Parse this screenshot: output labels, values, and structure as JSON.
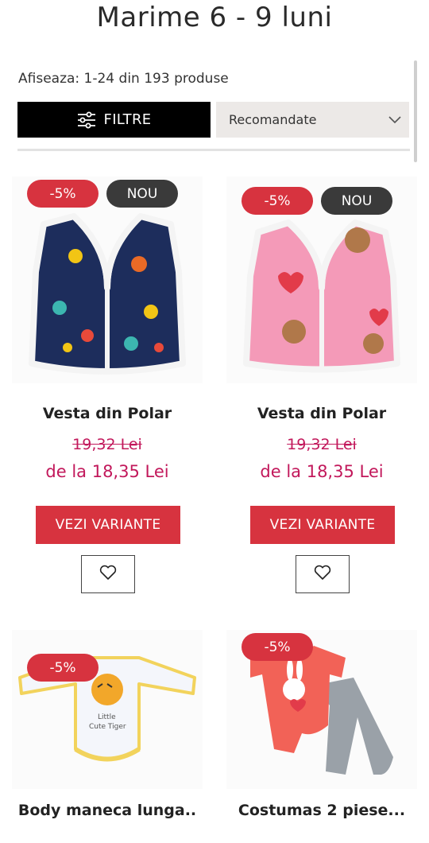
{
  "header": {
    "title": "Marime 6 - 9 luni"
  },
  "listing": {
    "results_text": "Afiseaza: 1-24 din 193 produse"
  },
  "toolbar": {
    "filter_label": "FILTRE",
    "filter_icon": "sliders-icon",
    "sort_selected": "Recomandate",
    "sort_icon": "chevron-down-icon"
  },
  "products": [
    {
      "name": "Vesta din Polar",
      "discount_badge": "-5%",
      "new_badge": "NOU",
      "old_price": "19,32 Lei",
      "price": "de la 18,35 Lei",
      "cta_label": "VEZI VARIANTE",
      "wish_icon": "heart-icon"
    },
    {
      "name": "Vesta din Polar",
      "discount_badge": "-5%",
      "new_badge": "NOU",
      "old_price": "19,32 Lei",
      "price": "de la 18,35 Lei",
      "cta_label": "VEZI VARIANTE",
      "wish_icon": "heart-icon"
    },
    {
      "name": "Body maneca lunga..",
      "discount_badge": "-5%"
    },
    {
      "name": "Costumas 2 piese...",
      "discount_badge": "-5%"
    }
  ],
  "colors": {
    "accent": "#d7333f",
    "price": "#c2185b",
    "dark_badge": "#3a3a3a"
  }
}
